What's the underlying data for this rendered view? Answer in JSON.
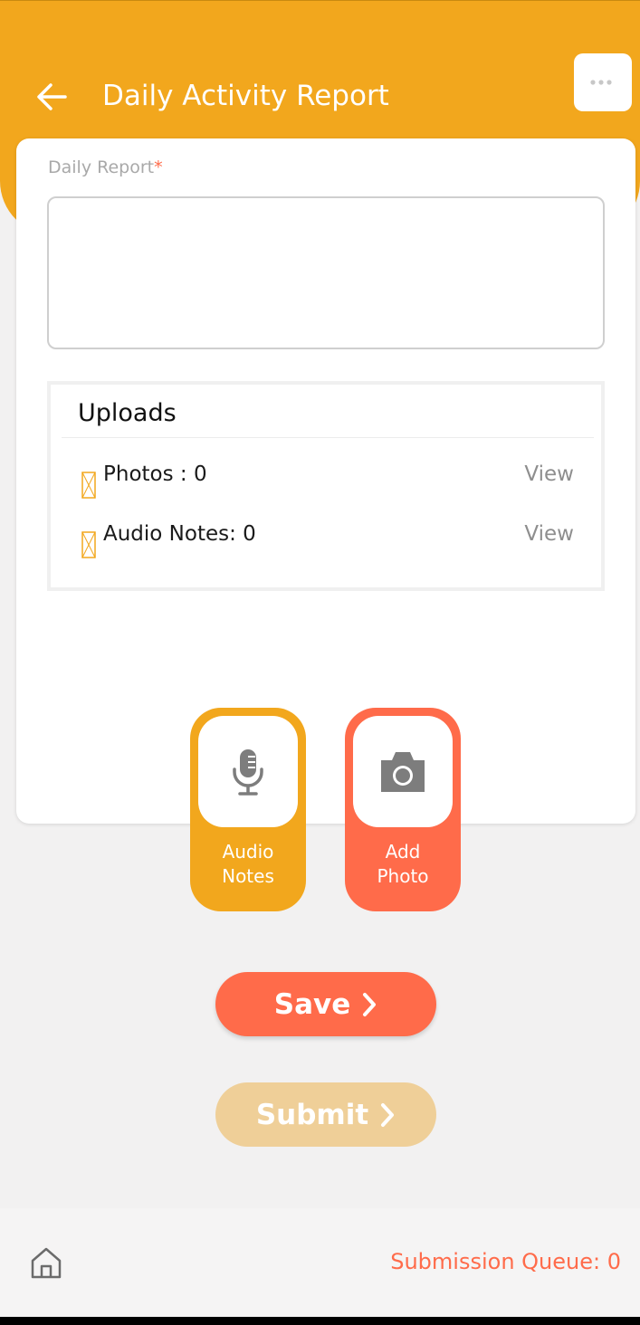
{
  "header": {
    "title": "Daily Activity Report",
    "back_icon": "arrow-left-icon",
    "menu_icon": "more-horizontal-icon",
    "accent_color": "#f2a71d"
  },
  "form": {
    "label": "Daily Report",
    "required_mark": "*",
    "value": ""
  },
  "uploads": {
    "title": "Uploads",
    "rows": [
      {
        "label": "Photos : 0",
        "action": "View"
      },
      {
        "label": "Audio Notes: 0",
        "action": "View"
      }
    ]
  },
  "actions": {
    "audio": {
      "line1": "Audio",
      "line2": "Notes",
      "icon": "microphone-icon",
      "color": "#f2a71d"
    },
    "photo": {
      "line1": "Add",
      "line2": "Photo",
      "icon": "camera-icon",
      "color": "#ff6b4a"
    }
  },
  "buttons": {
    "save": "Save",
    "submit": "Submit"
  },
  "footer": {
    "home_icon": "home-icon",
    "queue": "Submission Queue: 0"
  }
}
